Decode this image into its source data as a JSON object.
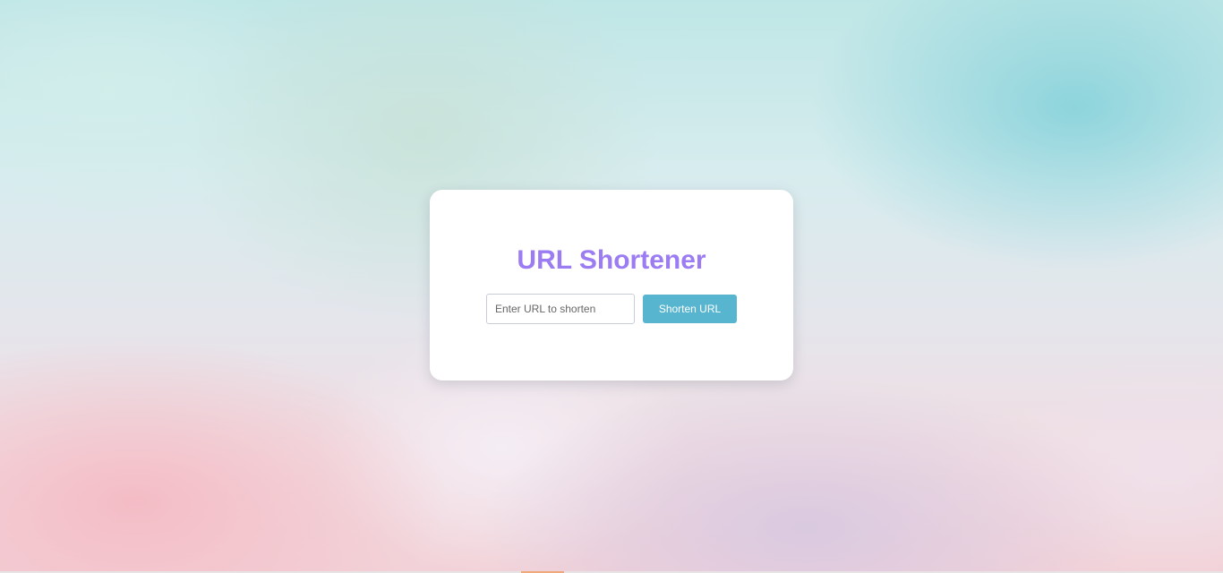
{
  "app": {
    "title": "URL Shortener"
  },
  "form": {
    "url_input": {
      "value": "",
      "placeholder": "Enter URL to shorten"
    },
    "submit_label": "Shorten URL"
  },
  "colors": {
    "title": "#9b7cf2",
    "button_bg": "#58b5cf",
    "button_text": "#ffffff",
    "card_bg": "#ffffff"
  }
}
